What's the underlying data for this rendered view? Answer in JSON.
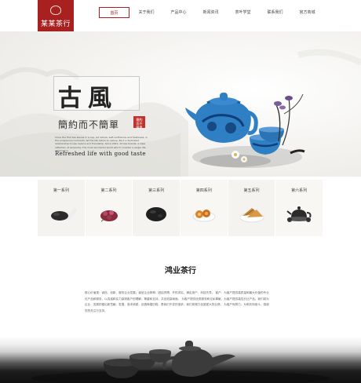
{
  "header": {
    "logo_text": "某某茶行",
    "nav": [
      {
        "label": "首页",
        "active": true
      },
      {
        "label": "关于我们",
        "active": false
      },
      {
        "label": "产品中心",
        "active": false
      },
      {
        "label": "新闻资讯",
        "active": false
      },
      {
        "label": "茶叶学堂",
        "active": false
      },
      {
        "label": "联系我们",
        "active": false
      },
      {
        "label": "官方商城",
        "active": false
      }
    ]
  },
  "banner": {
    "title": "古風",
    "subtitle": "簡約而不簡單",
    "seal_text": "簡約而不簡單",
    "tagline": "Refreshed life with good taste",
    "description": "Since the first tea leaves in a cup, let nature, self-confidence and freshness, in the prosperous moments, let the life return to nature. Be it a dedicated relationship to tea, leisure and friendship. Since 2011, 12 tea brands, a clear reflection of simplicity. The most wonderful world which consider a single life experience."
  },
  "series": [
    {
      "label": "第一系列",
      "icon": "tea-leaves-dark-icon"
    },
    {
      "label": "第二系列",
      "icon": "rose-tea-icon"
    },
    {
      "label": "第三系列",
      "icon": "black-tea-icon"
    },
    {
      "label": "第四系列",
      "icon": "dried-fruit-icon"
    },
    {
      "label": "第五系列",
      "icon": "snack-pieces-icon"
    },
    {
      "label": "第六系列",
      "icon": "teaset-icon"
    }
  ],
  "about": {
    "title": "鸿业茶行",
    "text": "核心价值观：诚信、创新、服务企业发展；诚信企业精神；团结拼搏、开拓求实、满足用户、科技先导。 客户：为客户提供高质量和最大价值的专业化产品和服务，以真诚和实力赢得客户的理解、尊重和支持，共创双赢局面。 为客户提供优质服务和无私奉献，为客户提供高性价比产品；我们将为企业、发展的做出新贡献。发展，追求卓越，创造辉煌历程，是我们不变的追求，我们将竭力创造更大的业绩。 为客户而努力，为明天而奋斗，感谢您的关注与支持。"
  },
  "colors": {
    "brand": "#a8201f",
    "background": "#ffffff",
    "card": "#f4f3ef",
    "porcelain_blue": "#2f7fc4"
  }
}
